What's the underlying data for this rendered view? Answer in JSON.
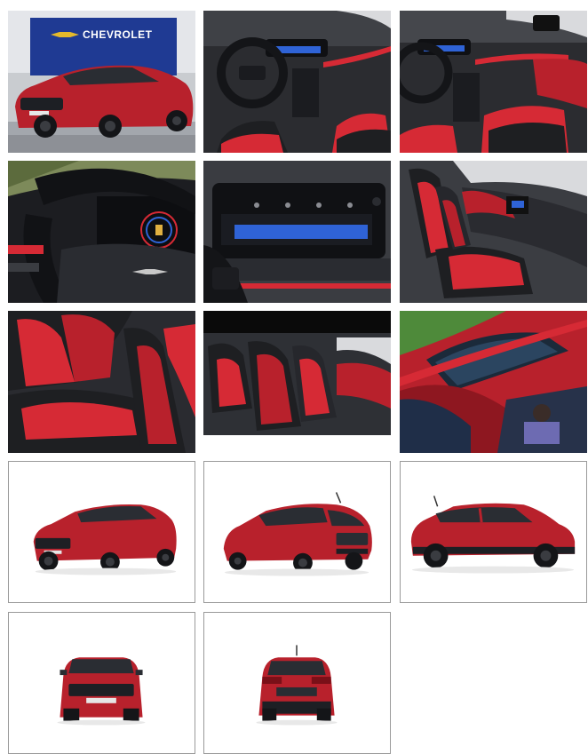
{
  "gallery": {
    "brand": {
      "wordmark": "CHEVROLET"
    },
    "colors": {
      "body_red": "#b8212c",
      "interior_black": "#1e1f22",
      "accent_red": "#d62a35",
      "screen_blue": "#2f63d6",
      "frame_gray": "#9a9a9a"
    },
    "tiles": [
      {
        "kind": "photo",
        "subject": "car-front-showroom"
      },
      {
        "kind": "photo",
        "subject": "dashboard-interior"
      },
      {
        "kind": "photo",
        "subject": "dashboard-passenger-side"
      },
      {
        "kind": "photo",
        "subject": "steering-wheel-cluster"
      },
      {
        "kind": "photo",
        "subject": "infotainment-screen"
      },
      {
        "kind": "photo",
        "subject": "front-seats-side"
      },
      {
        "kind": "photo",
        "subject": "rear-seats"
      },
      {
        "kind": "photo",
        "subject": "cabin-side-view"
      },
      {
        "kind": "photo",
        "subject": "panoramic-sunroof"
      },
      {
        "kind": "framed",
        "subject": "car-three-quarter-front"
      },
      {
        "kind": "framed",
        "subject": "car-three-quarter-rear"
      },
      {
        "kind": "framed",
        "subject": "car-side-profile"
      },
      {
        "kind": "framed",
        "subject": "car-front"
      },
      {
        "kind": "framed",
        "subject": "car-rear"
      }
    ]
  }
}
